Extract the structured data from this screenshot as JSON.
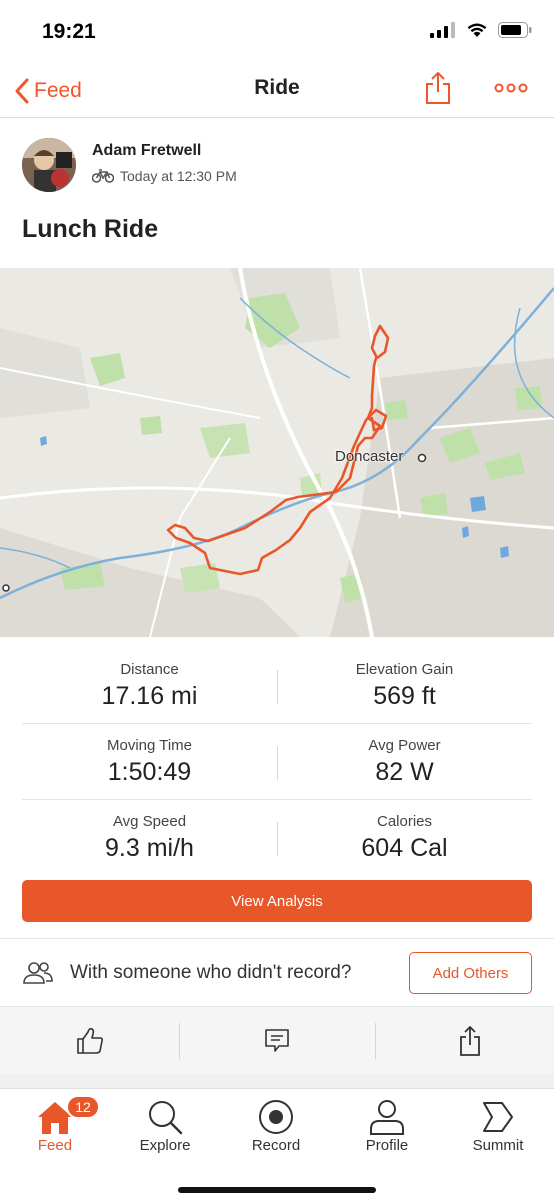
{
  "status_bar": {
    "time": "19:21"
  },
  "nav": {
    "back_label": "Feed",
    "title": "Ride"
  },
  "athlete": {
    "name": "Adam Fretwell",
    "meta": "Today at 12:30 PM"
  },
  "activity": {
    "title": "Lunch Ride"
  },
  "map": {
    "city_label": "Doncaster",
    "route_color": "#e8572a"
  },
  "stats": {
    "distance": {
      "label": "Distance",
      "value": "17.16 mi"
    },
    "elevation": {
      "label": "Elevation Gain",
      "value": "569 ft"
    },
    "moving_time": {
      "label": "Moving Time",
      "value": "1:50:49"
    },
    "avg_power": {
      "label": "Avg Power",
      "value": "82 W"
    },
    "avg_speed": {
      "label": "Avg Speed",
      "value": "9.3 mi/h"
    },
    "calories": {
      "label": "Calories",
      "value": "604 Cal"
    }
  },
  "analysis_button": "View Analysis",
  "with_someone": {
    "text": "With someone who didn't record?",
    "button": "Add Others"
  },
  "tabs": {
    "feed": {
      "label": "Feed",
      "badge": "12"
    },
    "explore": {
      "label": "Explore"
    },
    "record": {
      "label": "Record"
    },
    "profile": {
      "label": "Profile"
    },
    "summit": {
      "label": "Summit"
    }
  },
  "colors": {
    "accent": "#e8572a"
  }
}
